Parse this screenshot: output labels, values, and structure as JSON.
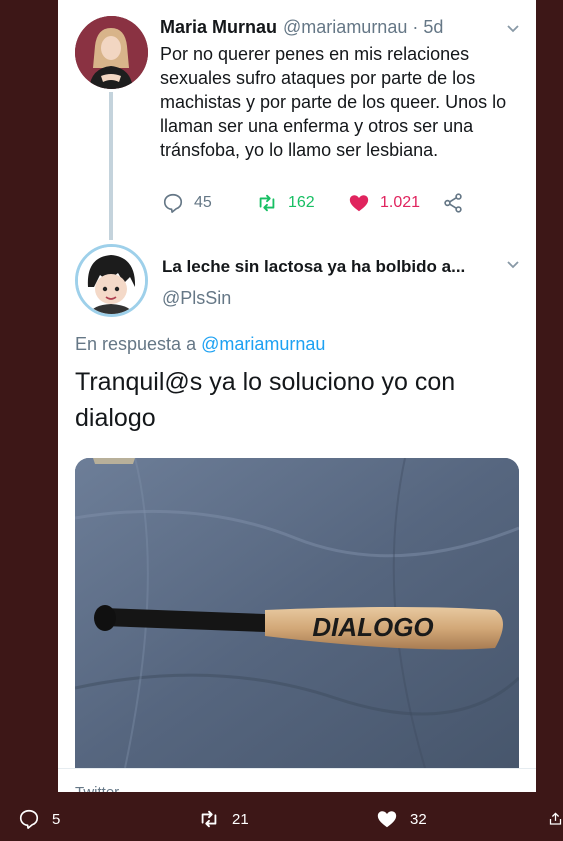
{
  "tweet1": {
    "name": "Maria Murnau",
    "handle": "@mariamurnau · 5d",
    "text": "Por no querer penes en mis relaciones sexuales sufro ataques por parte de los machistas y por parte de los queer. Unos lo llaman ser una enferma y otros ser una tránsfoba, yo lo llamo ser lesbiana.",
    "replies": "45",
    "retweets": "162",
    "likes": "1.021"
  },
  "tweet2": {
    "name": "La leche sin lactosa ya ha bolbido a...",
    "handle": "@PlsSin",
    "reply_prefix": "En respuesta a",
    "reply_mention": "@mariamurnau",
    "text": "Tranquil@s ya lo soluciono yo con dialogo",
    "image_text": "DIALOGO",
    "footer": "Twitter"
  },
  "bottom_bar": {
    "replies": "5",
    "retweets": "21",
    "likes": "32"
  },
  "colors": {
    "background": "#3d1717",
    "card": "#ffffff",
    "retweet": "#17bf63",
    "like": "#e0245e",
    "link": "#1da1f2",
    "muted": "#657786"
  },
  "icons": [
    "reply-icon",
    "retweet-icon",
    "heart-icon",
    "share-icon",
    "chevron-down-icon"
  ]
}
